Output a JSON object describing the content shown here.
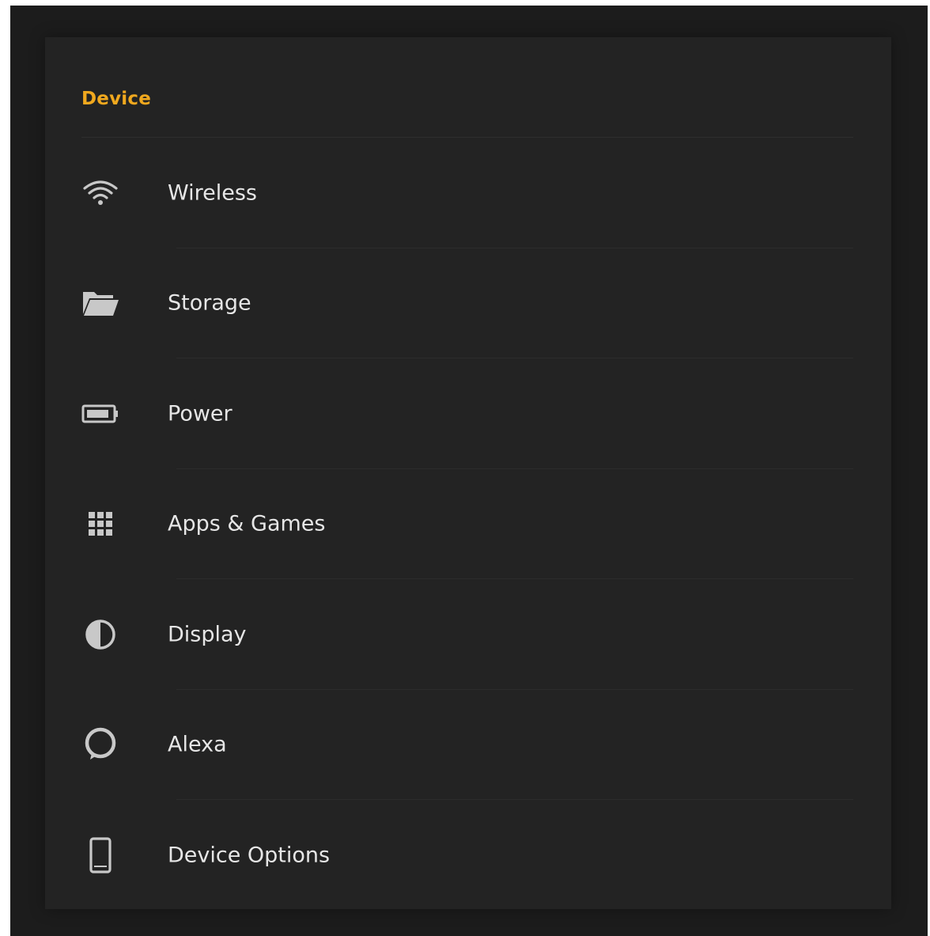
{
  "section": {
    "title": "Device"
  },
  "items": [
    {
      "label": "Wireless",
      "icon": "wifi-icon"
    },
    {
      "label": "Storage",
      "icon": "folder-icon"
    },
    {
      "label": "Power",
      "icon": "battery-icon"
    },
    {
      "label": "Apps & Games",
      "icon": "apps-grid-icon"
    },
    {
      "label": "Display",
      "icon": "contrast-icon"
    },
    {
      "label": "Alexa",
      "icon": "alexa-ring-icon"
    },
    {
      "label": "Device Options",
      "icon": "tablet-icon"
    }
  ],
  "colors": {
    "accent": "#f0a81e",
    "background": "#232323",
    "text": "#e6e6e6",
    "icon": "#c8c8c8"
  }
}
